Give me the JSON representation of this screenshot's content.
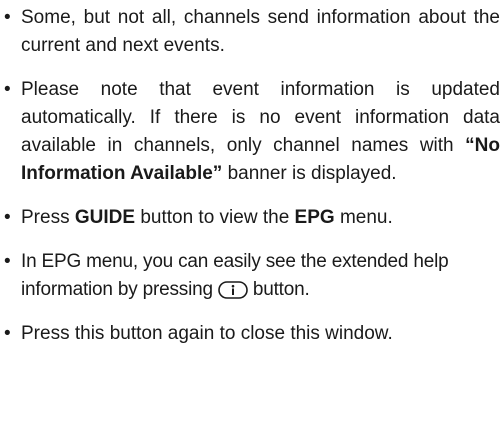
{
  "colors": {
    "text": "#1a1a1a",
    "background": "#ffffff"
  },
  "bullet": "•",
  "items": [
    {
      "text": "Some, but not all, channels send information about the current and next events."
    },
    {
      "part1": "Please note that event information is updated automatically. If there is no event information data available in channels, only channel names with ",
      "bold": "“No Information Available”",
      "part2": " banner is displayed."
    },
    {
      "part1": "Press ",
      "bold1": "GUIDE",
      "part2": " button to view the ",
      "bold2": "EPG",
      "part3": " menu."
    },
    {
      "part1": "In EPG menu, you can easily see the extended help information by pressing",
      "icon": "info-button-icon",
      "part2": "button."
    },
    {
      "text": "Press this button again to close this window."
    }
  ]
}
